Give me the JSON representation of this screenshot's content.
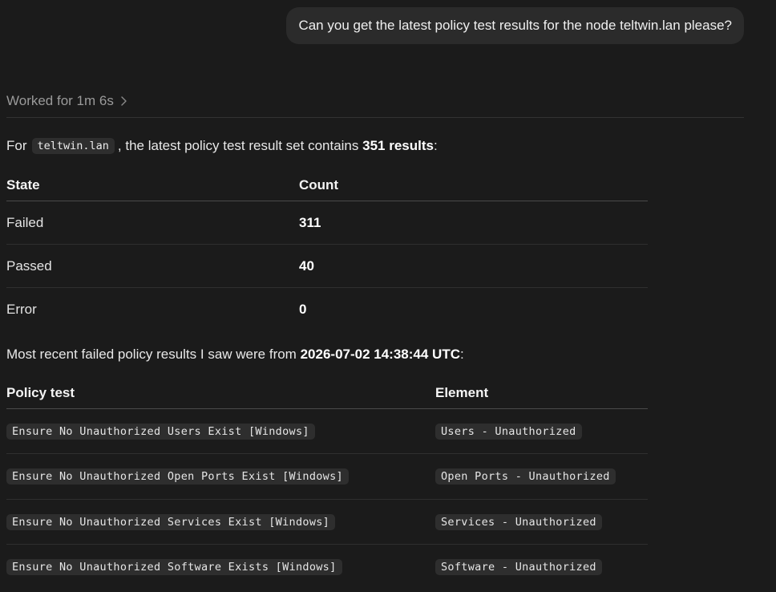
{
  "user_message": "Can you get the latest policy test results for the node teltwin.lan please?",
  "worked": {
    "label": "Worked for 1m 6s"
  },
  "summary": {
    "prefix": "For",
    "node": "teltwin.lan",
    "middle": ", the latest policy test result set contains",
    "total": "351 results",
    "suffix": ":"
  },
  "state_table": {
    "headers": [
      "State",
      "Count"
    ],
    "rows": [
      {
        "state": "Failed",
        "count": "311"
      },
      {
        "state": "Passed",
        "count": "40"
      },
      {
        "state": "Error",
        "count": "0"
      }
    ]
  },
  "recent": {
    "prefix": "Most recent failed policy results I saw were from",
    "timestamp": "2026-07-02 14:38:44 UTC",
    "suffix": ":"
  },
  "policy_table": {
    "headers": [
      "Policy test",
      "Element"
    ],
    "rows": [
      {
        "test": "Ensure No Unauthorized Users Exist [Windows]",
        "element": "Users - Unauthorized"
      },
      {
        "test": "Ensure No Unauthorized Open Ports Exist [Windows]",
        "element": "Open Ports - Unauthorized"
      },
      {
        "test": "Ensure No Unauthorized Services Exist [Windows]",
        "element": "Services - Unauthorized"
      },
      {
        "test": "Ensure No Unauthorized Software Exists [Windows]",
        "element": "Software - Unauthorized"
      }
    ]
  }
}
